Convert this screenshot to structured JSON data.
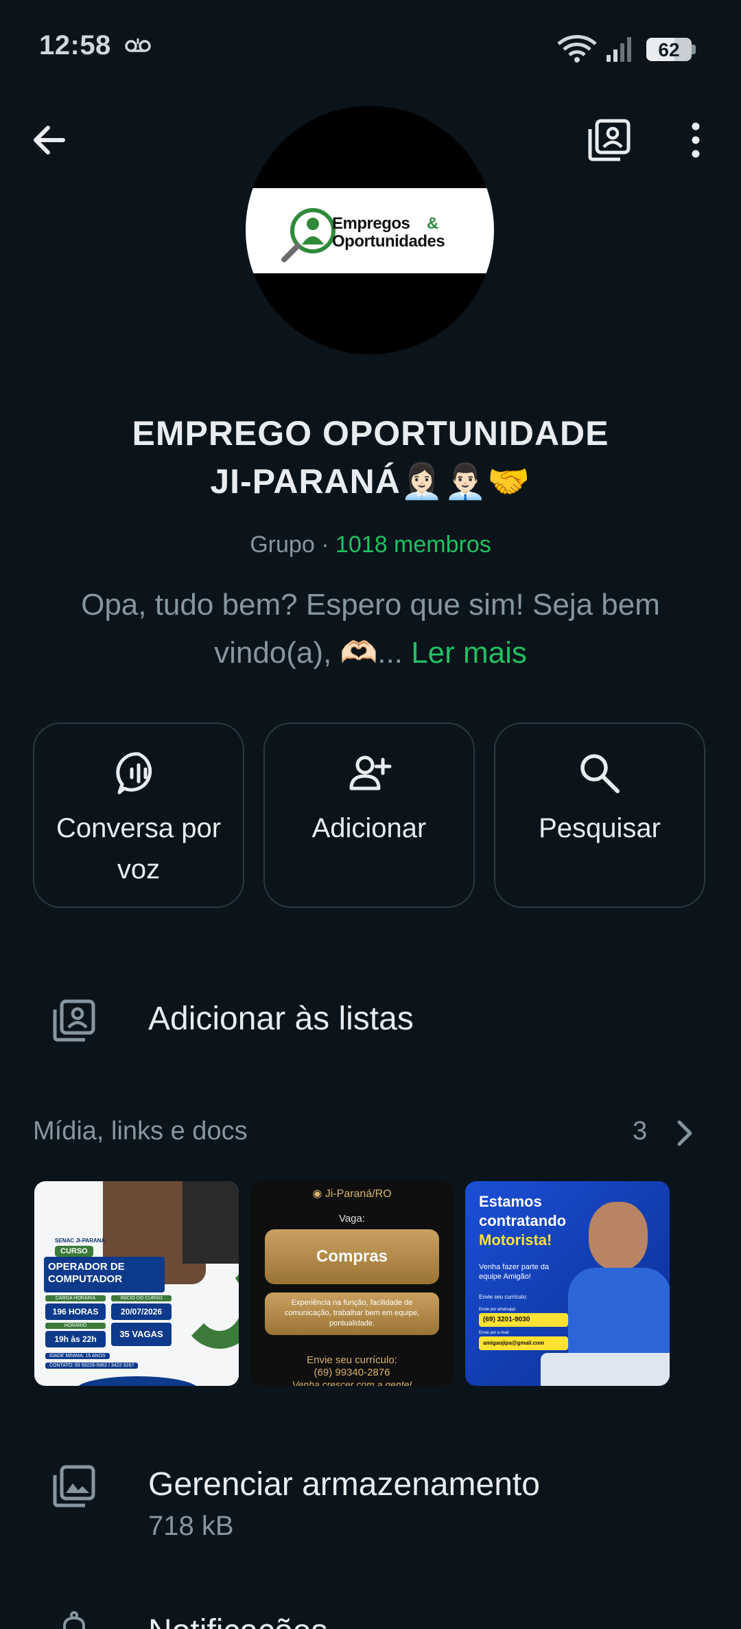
{
  "status_bar": {
    "time": "12:58",
    "battery": "62",
    "icons": [
      "voicemail-icon",
      "wifi-icon",
      "signal-icon",
      "battery-icon"
    ]
  },
  "header": {
    "icons": [
      "back-arrow-icon",
      "add-to-list-icon",
      "more-vert-icon"
    ]
  },
  "avatar": {
    "logo_line1": "Empregos",
    "logo_amp": "&",
    "logo_line2": "Oportunidades"
  },
  "group": {
    "name_line1": "EMPREGO OPORTUNIDADE",
    "name_line2": "JI-PARANÁ👩🏻‍💼👨🏻‍💼🤝",
    "type": "Grupo",
    "separator": "·",
    "members": "1018 membros",
    "description_line1": "Opa, tudo bem? Espero que sim! Seja bem",
    "description_line2": "vindo(a), 🫶🏻...",
    "read_more": "Ler mais"
  },
  "actions": [
    {
      "label_line1": "Conversa por",
      "label_line2": "voz",
      "icon": "voice-chat-icon"
    },
    {
      "label_line1": "Adicionar",
      "label_line2": "",
      "icon": "add-person-icon"
    },
    {
      "label_line1": "Pesquisar",
      "label_line2": "",
      "icon": "search-icon"
    }
  ],
  "lists_row": {
    "label": "Adicionar às listas",
    "icon": "add-to-list-icon"
  },
  "media": {
    "label": "Mídia, links e docs",
    "count": "3",
    "thumb1": {
      "org": "SENAC JI-PARANÁ",
      "badge": "CURSO",
      "title_line1": "OPERADOR DE",
      "title_line2": "COMPUTADOR",
      "carga_label": "CARGA HORÁRIA",
      "carga_value": "196 HORAS",
      "inicio_label": "INÍCIO DO CURSO",
      "inicio_value": "20/07/2026",
      "horario_label": "HORÁRIO",
      "horario_value": "19h às 22h",
      "vagas": "35 VAGAS",
      "idade": "IDADE MÍNIMA: 15 ANOS",
      "contato": "CONTATO: 69 99226-5962 / 3422-3267"
    },
    "thumb2": {
      "location": "Ji-Paraná/RO",
      "vaga_label": "Vaga:",
      "vaga_value": "Compras",
      "requisitos": "Experiência na função, facilidade de comunicação, trabalhar bem em equipe, pontualidade.",
      "envie": "Envie seu currículo:",
      "phone": "(69) 99340-2876",
      "footer": "Venha crescer com a gente!"
    },
    "thumb3": {
      "line1": "Estamos",
      "line2": "contratando",
      "line3": "Motorista!",
      "team": "Venha fazer parte da equipe Amigão!",
      "envie": "Envie seu currículo:",
      "whats_label": "Envie por whatsapp:",
      "whats": "(69) 3201-9030",
      "email_label": "Envie por e-mail:",
      "email": "amigaojipa@gmail.com"
    }
  },
  "storage_row": {
    "label": "Gerenciar armazenamento",
    "size": "718 kB",
    "icon": "storage-icon"
  },
  "notifications_row": {
    "label": "Notificações",
    "icon": "bell-icon"
  }
}
